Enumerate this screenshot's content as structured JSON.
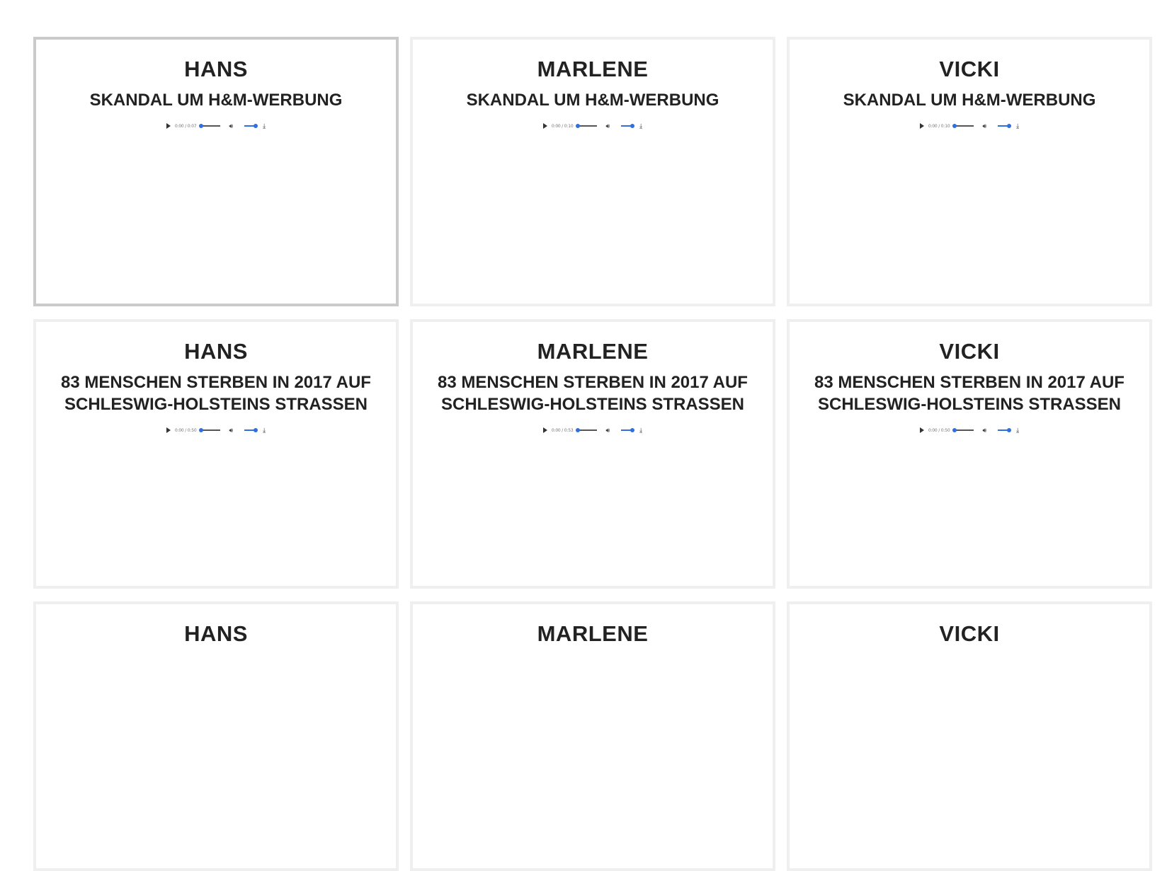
{
  "cards": [
    {
      "speaker": "HANS",
      "headline": "SKANDAL UM H&M-WERBUNG",
      "time": "0:00 / 0:07",
      "selected": true
    },
    {
      "speaker": "MARLENE",
      "headline": "SKANDAL UM H&M-WERBUNG",
      "time": "0:00 / 0:10",
      "selected": false
    },
    {
      "speaker": "VICKI",
      "headline": "SKANDAL UM H&M-WERBUNG",
      "time": "0:00 / 0:10",
      "selected": false
    },
    {
      "speaker": "HANS",
      "headline": "83 MENSCHEN STERBEN IN 2017 AUF SCHLESWIG-HOLSTEINS STRASSEN",
      "time": "0:00 / 0:50",
      "selected": false
    },
    {
      "speaker": "MARLENE",
      "headline": "83 MENSCHEN STERBEN IN 2017 AUF SCHLESWIG-HOLSTEINS STRASSEN",
      "time": "0:00 / 0:53",
      "selected": false
    },
    {
      "speaker": "VICKI",
      "headline": "83 MENSCHEN STERBEN IN 2017 AUF SCHLESWIG-HOLSTEINS STRASSEN",
      "time": "0:00 / 0:50",
      "selected": false
    },
    {
      "speaker": "HANS",
      "headline": "",
      "time": "",
      "selected": false
    },
    {
      "speaker": "MARLENE",
      "headline": "",
      "time": "",
      "selected": false
    },
    {
      "speaker": "VICKI",
      "headline": "",
      "time": "",
      "selected": false
    }
  ],
  "icons": {
    "play": "play-icon",
    "volume": "volume-icon",
    "download": "download-icon"
  },
  "colors": {
    "accent": "#2f6fe0",
    "card_border": "#efefef",
    "selected_border": "#cacaca"
  }
}
